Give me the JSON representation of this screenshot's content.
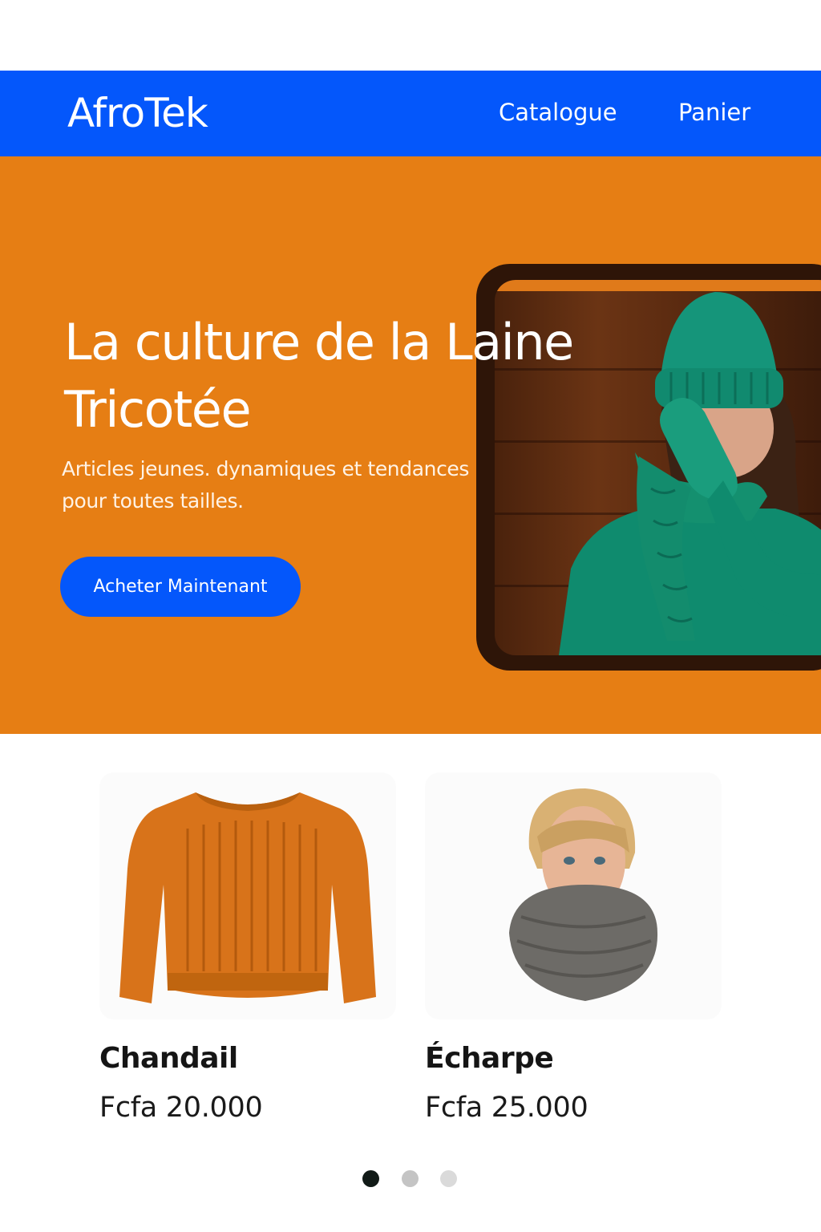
{
  "header": {
    "brand": "AfroTek",
    "nav": {
      "catalogue": "Catalogue",
      "panier": "Panier"
    }
  },
  "hero": {
    "title_line1": "La culture de la Laine",
    "title_line2": "Tricotée",
    "subtitle_line1": "Articles jeunes. dynamiques et tendances",
    "subtitle_line2": "pour toutes tailles.",
    "cta_label": "Acheter Maintenant"
  },
  "products": [
    {
      "name": "Chandail",
      "price": "Fcfa 20.000"
    },
    {
      "name": "Écharpe",
      "price": "Fcfa 25.000"
    }
  ],
  "carousel": {
    "active_index": 1,
    "count": 3
  },
  "colors": {
    "nav_blue": "#0457fb",
    "hero_orange": "#e67e14",
    "button_blue": "#0457fb"
  }
}
